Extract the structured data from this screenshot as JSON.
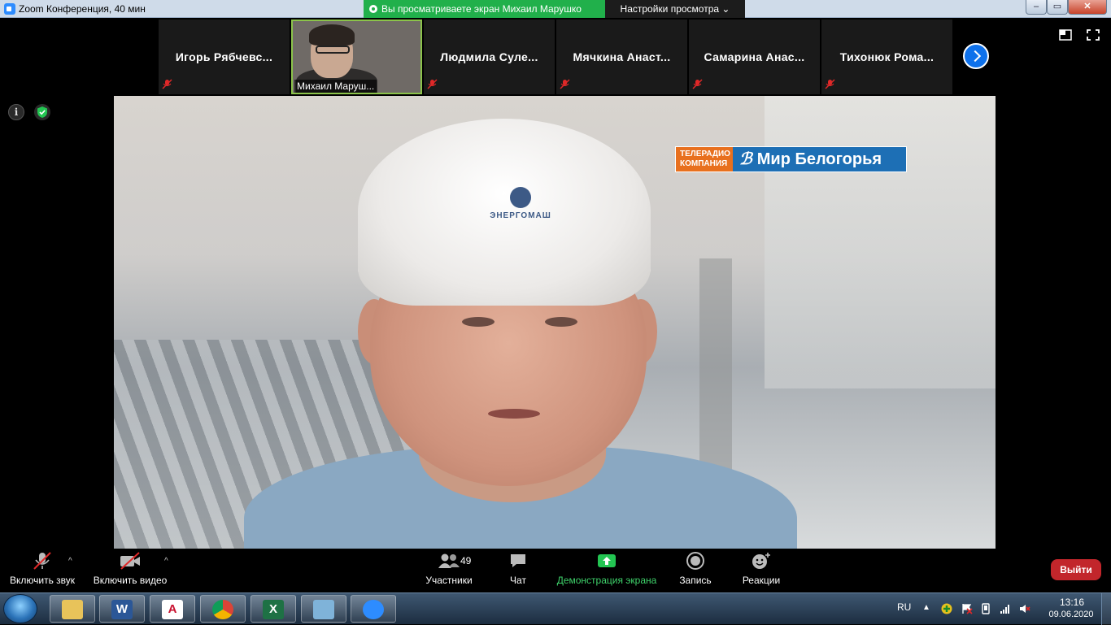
{
  "window": {
    "title": "Zoom Конференция, 40 мин",
    "share_banner": "Вы просматриваете экран Михаил Марушко",
    "view_options": "Настройки просмотра ⌄"
  },
  "participants": [
    {
      "name": "Игорь  Рябчевс...",
      "muted": true
    },
    {
      "name": "Михаил Маруш...",
      "active_speaker": true
    },
    {
      "name": "Людмила  Суле...",
      "muted": true
    },
    {
      "name": "Мячкина  Анаст...",
      "muted": true
    },
    {
      "name": "Самарина  Анас...",
      "muted": true
    },
    {
      "name": "Тихонюк  Рома...",
      "muted": true
    }
  ],
  "shared_content": {
    "tv_logo_small": "ТЕЛЕРАДИО КОМПАНИЯ",
    "tv_logo_main": "Мир Белогорья",
    "helmet_text": "ЭНЕРГОМАШ"
  },
  "toolbar": {
    "unmute_label": "Включить звук",
    "video_label": "Включить видео",
    "participants_label": "Участники",
    "participants_count": "49",
    "chat_label": "Чат",
    "share_label": "Демонстрация экрана",
    "record_label": "Запись",
    "reactions_label": "Реакции",
    "leave_label": "Выйти"
  },
  "colors": {
    "share_green": "#21b04b",
    "leave_red": "#c2262b",
    "accent_blue": "#0e71eb"
  },
  "taskbar": {
    "apps": [
      "file-explorer",
      "microsoft-word",
      "autocad",
      "google-chrome",
      "microsoft-excel",
      "remote-desktop",
      "zoom"
    ],
    "language": "RU",
    "time": "13:16",
    "date": "09.06.2020"
  }
}
